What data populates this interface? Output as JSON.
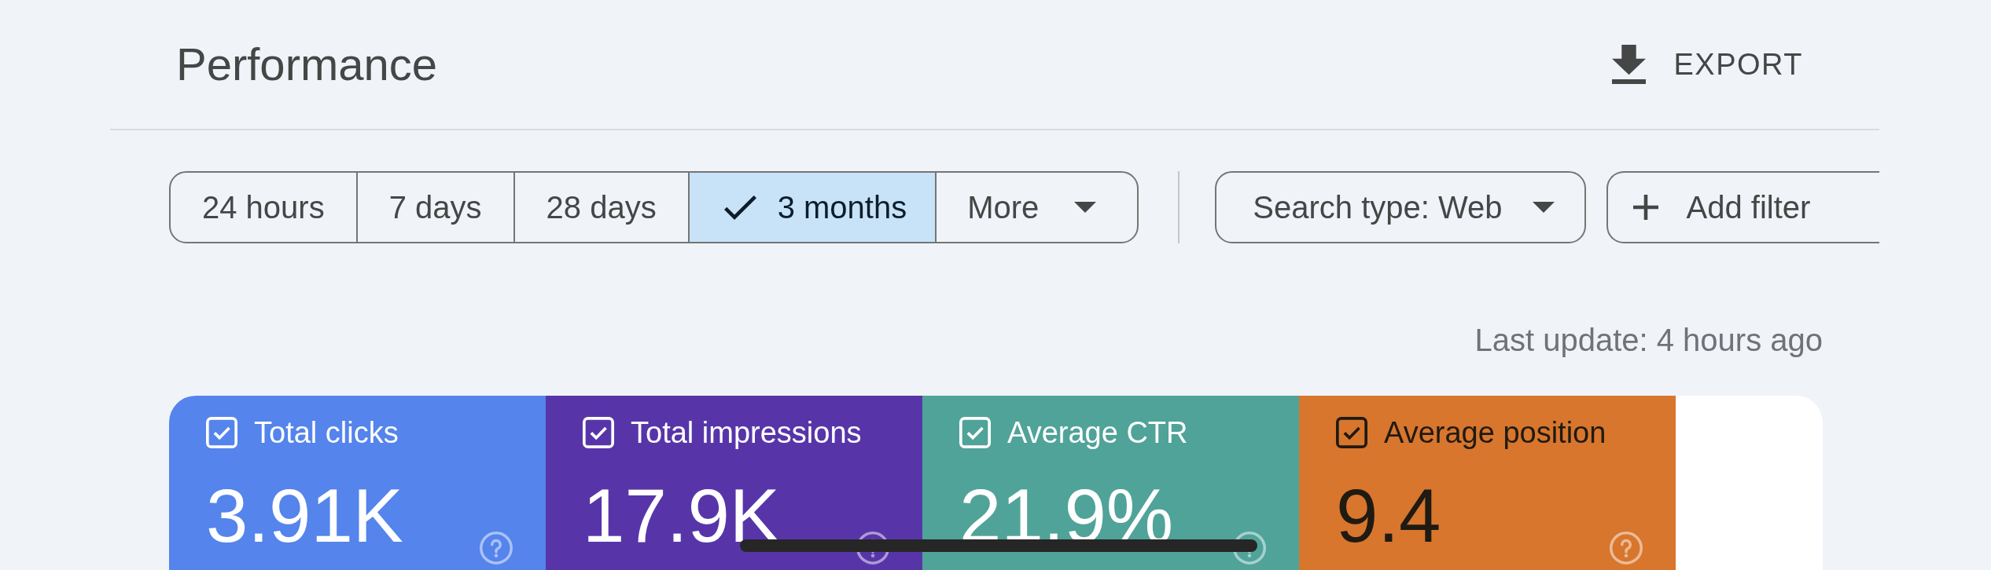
{
  "header": {
    "title": "Performance",
    "export_button": "EXPORT"
  },
  "date_ranges": [
    {
      "label": "24 hours",
      "selected": false
    },
    {
      "label": "7 days",
      "selected": false
    },
    {
      "label": "28 days",
      "selected": false
    },
    {
      "label": "3 months",
      "selected": true
    }
  ],
  "more_button": "More",
  "filters": {
    "search_type": "Search type: Web",
    "add_filter": "Add filter"
  },
  "last_update": "Last update: 4 hours ago",
  "metrics": [
    {
      "label": "Total clicks",
      "value": "3.91K",
      "checked": true,
      "color": "#5484ec",
      "dark_text": false
    },
    {
      "label": "Total impressions",
      "value": "17.9K",
      "checked": true,
      "color": "#5735a9",
      "dark_text": false
    },
    {
      "label": "Average CTR",
      "value": "21.9%",
      "checked": true,
      "color": "#50a398",
      "dark_text": false
    },
    {
      "label": "Average position",
      "value": "9.4",
      "checked": true,
      "color": "#d8762d",
      "dark_text": true
    }
  ]
}
